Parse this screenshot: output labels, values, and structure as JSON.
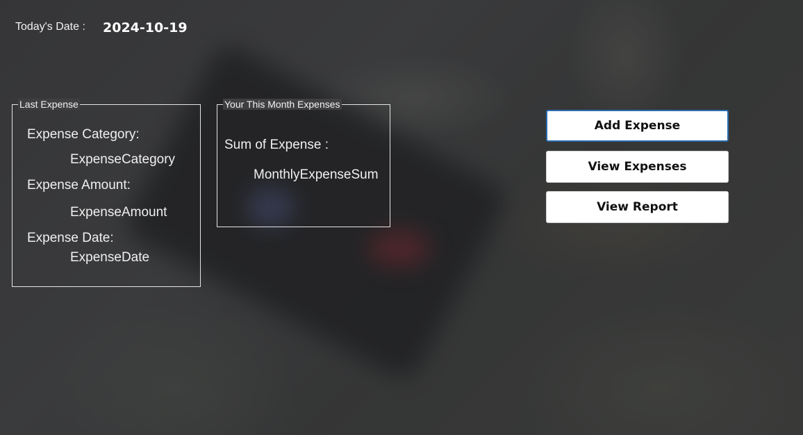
{
  "header": {
    "date_label": "Today's Date :",
    "date_value": "2024-10-19"
  },
  "last_expense": {
    "title": "Last Expense",
    "category_label": "Expense Category:",
    "category_value": "ExpenseCategory",
    "amount_label": "Expense Amount:",
    "amount_value": "ExpenseAmount",
    "date_label": "Expense Date:",
    "date_value": "ExpenseDate"
  },
  "month_expenses": {
    "title": "Your This Month Expenses",
    "sum_label": "Sum of Expense :",
    "sum_value": "MonthlyExpenseSum"
  },
  "actions": {
    "add_label": "Add Expense",
    "view_label": "View Expenses",
    "report_label": "View Report"
  },
  "colors": {
    "focus_border": "#2b6cb0",
    "text": "#f0f0f0",
    "button_bg": "#ffffff"
  }
}
